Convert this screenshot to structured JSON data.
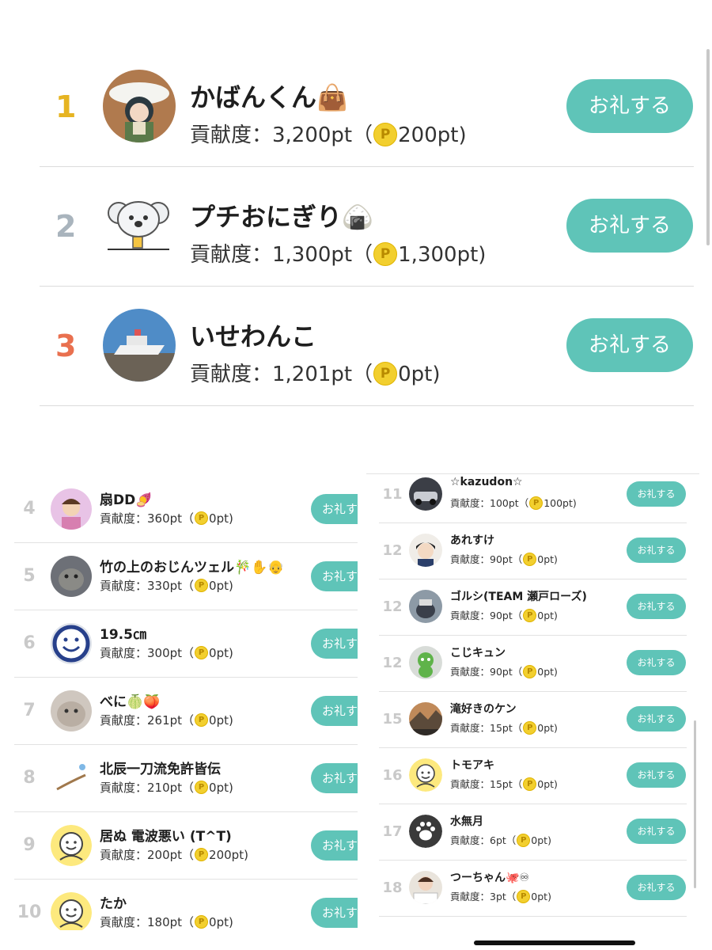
{
  "big_list": [
    {
      "rank": "1",
      "rank_color": "#e6b422",
      "name": "かばんくん👜",
      "score_prefix": "貢献度：3,200pt（",
      "coin": "P",
      "score_suffix": "200pt)",
      "button": "お礼する"
    },
    {
      "rank": "2",
      "rank_color": "#a9b4bd",
      "name": "プチおにぎり🍙",
      "score_prefix": "貢献度：1,300pt（",
      "coin": "P",
      "score_suffix": "1,300pt)",
      "button": "お礼する"
    },
    {
      "rank": "3",
      "rank_color": "#e9704f",
      "name": "いせわんこ",
      "score_prefix": "貢献度：1,201pt（",
      "coin": "P",
      "score_suffix": "0pt)",
      "button": "お礼する"
    }
  ],
  "left_list": [
    {
      "rank": "4",
      "name": "扇DD🍠",
      "score_prefix": "貢献度：360pt（",
      "coin": "P",
      "score_suffix": "0pt)",
      "button": "お礼す"
    },
    {
      "rank": "5",
      "name": "竹の上のおじんツェル🎋✋👴",
      "score_prefix": "貢献度：330pt（",
      "coin": "P",
      "score_suffix": "0pt)",
      "button": "お礼す"
    },
    {
      "rank": "6",
      "name": "19.5㎝",
      "score_prefix": "貢献度：300pt（",
      "coin": "P",
      "score_suffix": "0pt)",
      "button": "お礼す"
    },
    {
      "rank": "7",
      "name": "べに🍈🍑",
      "score_prefix": "貢献度：261pt（",
      "coin": "P",
      "score_suffix": "0pt)",
      "button": "お礼す"
    },
    {
      "rank": "8",
      "name": "北辰一刀流免許皆伝",
      "score_prefix": "貢献度：210pt（",
      "coin": "P",
      "score_suffix": "0pt)",
      "button": "お礼す"
    },
    {
      "rank": "9",
      "name": "居ぬ 電波悪い (T^T)",
      "score_prefix": "貢献度：200pt（",
      "coin": "P",
      "score_suffix": "200pt)",
      "button": "お礼す"
    },
    {
      "rank": "10",
      "name": "たか",
      "score_prefix": "貢献度：180pt（",
      "coin": "P",
      "score_suffix": "0pt)",
      "button": "お礼す"
    }
  ],
  "right_list": [
    {
      "rank": "11",
      "name": "☆kazudon☆",
      "score_prefix": "貢献度：100pt（",
      "coin": "P",
      "score_suffix": "100pt)",
      "button": "お礼する"
    },
    {
      "rank": "12",
      "name": "あれすけ",
      "score_prefix": "貢献度：90pt（",
      "coin": "P",
      "score_suffix": "0pt)",
      "button": "お礼する"
    },
    {
      "rank": "12",
      "name": "ゴルシ(TEAM 瀬戸ローズ)",
      "score_prefix": "貢献度：90pt（",
      "coin": "P",
      "score_suffix": "0pt)",
      "button": "お礼する"
    },
    {
      "rank": "12",
      "name": "こじキュン",
      "score_prefix": "貢献度：90pt（",
      "coin": "P",
      "score_suffix": "0pt)",
      "button": "お礼する"
    },
    {
      "rank": "15",
      "name": "滝好きのケン",
      "score_prefix": "貢献度：15pt（",
      "coin": "P",
      "score_suffix": "0pt)",
      "button": "お礼する"
    },
    {
      "rank": "16",
      "name": "トモアキ",
      "score_prefix": "貢献度：15pt（",
      "coin": "P",
      "score_suffix": "0pt)",
      "button": "お礼する"
    },
    {
      "rank": "17",
      "name": "水無月",
      "score_prefix": "貢献度：6pt（",
      "coin": "P",
      "score_suffix": "0pt)",
      "button": "お礼する"
    },
    {
      "rank": "18",
      "name": "つーちゃん🐙♾",
      "score_prefix": "貢献度：3pt（",
      "coin": "P",
      "score_suffix": "0pt)",
      "button": "お礼する"
    }
  ]
}
